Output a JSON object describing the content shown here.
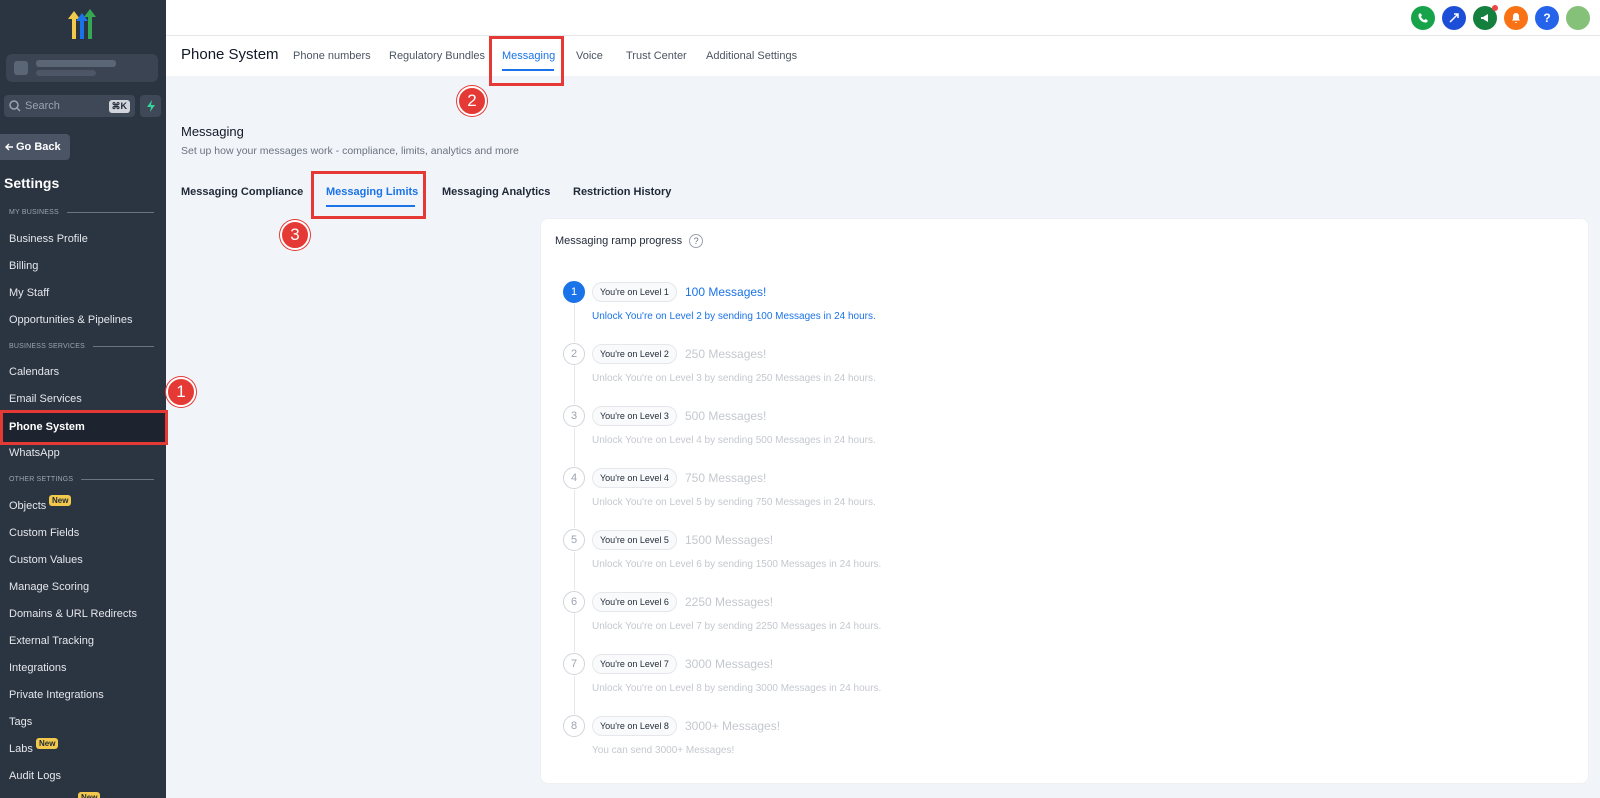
{
  "sidebar": {
    "search_placeholder": "Search",
    "search_shortcut": "⌘K",
    "go_back": "Go Back",
    "settings_title": "Settings",
    "sections": {
      "my_business": "MY BUSINESS",
      "business_services": "BUSINESS SERVICES",
      "other_settings": "OTHER SETTINGS"
    },
    "items": {
      "business_profile": "Business Profile",
      "billing": "Billing",
      "my_staff": "My Staff",
      "opportunities": "Opportunities & Pipelines",
      "calendars": "Calendars",
      "email_services": "Email Services",
      "phone_system": "Phone System",
      "whatsapp": "WhatsApp",
      "objects": "Objects",
      "custom_fields": "Custom Fields",
      "custom_values": "Custom Values",
      "manage_scoring": "Manage Scoring",
      "domains": "Domains & URL Redirects",
      "external_tracking": "External Tracking",
      "integrations": "Integrations",
      "private_integrations": "Private Integrations",
      "tags": "Tags",
      "labs": "Labs",
      "audit_logs": "Audit Logs"
    },
    "new_badge": "New"
  },
  "header": {
    "title": "Phone System",
    "tabs": {
      "phone_numbers": "Phone numbers",
      "regulatory_bundles": "Regulatory Bundles",
      "messaging": "Messaging",
      "voice": "Voice",
      "trust_center": "Trust Center",
      "additional_settings": "Additional Settings"
    }
  },
  "page": {
    "title": "Messaging",
    "subtitle": "Set up how your messages work - compliance, limits, analytics and more",
    "subtabs": {
      "compliance": "Messaging Compliance",
      "limits": "Messaging Limits",
      "analytics": "Messaging Analytics",
      "restriction_history": "Restriction History"
    }
  },
  "card": {
    "title": "Messaging ramp progress",
    "help": "?",
    "levels": [
      {
        "num": "1",
        "pill": "You're on Level 1",
        "messages": "100 Messages!",
        "unlock": "Unlock You're on Level 2 by sending 100 Messages in 24 hours."
      },
      {
        "num": "2",
        "pill": "You're on Level 2",
        "messages": "250 Messages!",
        "unlock": "Unlock You're on Level 3 by sending 250 Messages in 24 hours."
      },
      {
        "num": "3",
        "pill": "You're on Level 3",
        "messages": "500 Messages!",
        "unlock": "Unlock You're on Level 4 by sending 500 Messages in 24 hours."
      },
      {
        "num": "4",
        "pill": "You're on Level 4",
        "messages": "750 Messages!",
        "unlock": "Unlock You're on Level 5 by sending 750 Messages in 24 hours."
      },
      {
        "num": "5",
        "pill": "You're on Level 5",
        "messages": "1500 Messages!",
        "unlock": "Unlock You're on Level 6 by sending 1500 Messages in 24 hours."
      },
      {
        "num": "6",
        "pill": "You're on Level 6",
        "messages": "2250 Messages!",
        "unlock": "Unlock You're on Level 7 by sending 2250 Messages in 24 hours."
      },
      {
        "num": "7",
        "pill": "You're on Level 7",
        "messages": "3000 Messages!",
        "unlock": "Unlock You're on Level 8 by sending 3000 Messages in 24 hours."
      },
      {
        "num": "8",
        "pill": "You're on Level 8",
        "messages": "3000+ Messages!",
        "unlock": "You can send 3000+ Messages!"
      }
    ]
  },
  "annotations": {
    "step1": "1",
    "step2": "2",
    "step3": "3"
  },
  "colors": {
    "accent": "#1a73e8",
    "annotation": "#e53935",
    "sidebar_bg": "#2b3441"
  },
  "topbar_icons": [
    "phone-icon",
    "link-icon",
    "megaphone-icon",
    "bell-icon",
    "help-icon",
    "avatar"
  ]
}
